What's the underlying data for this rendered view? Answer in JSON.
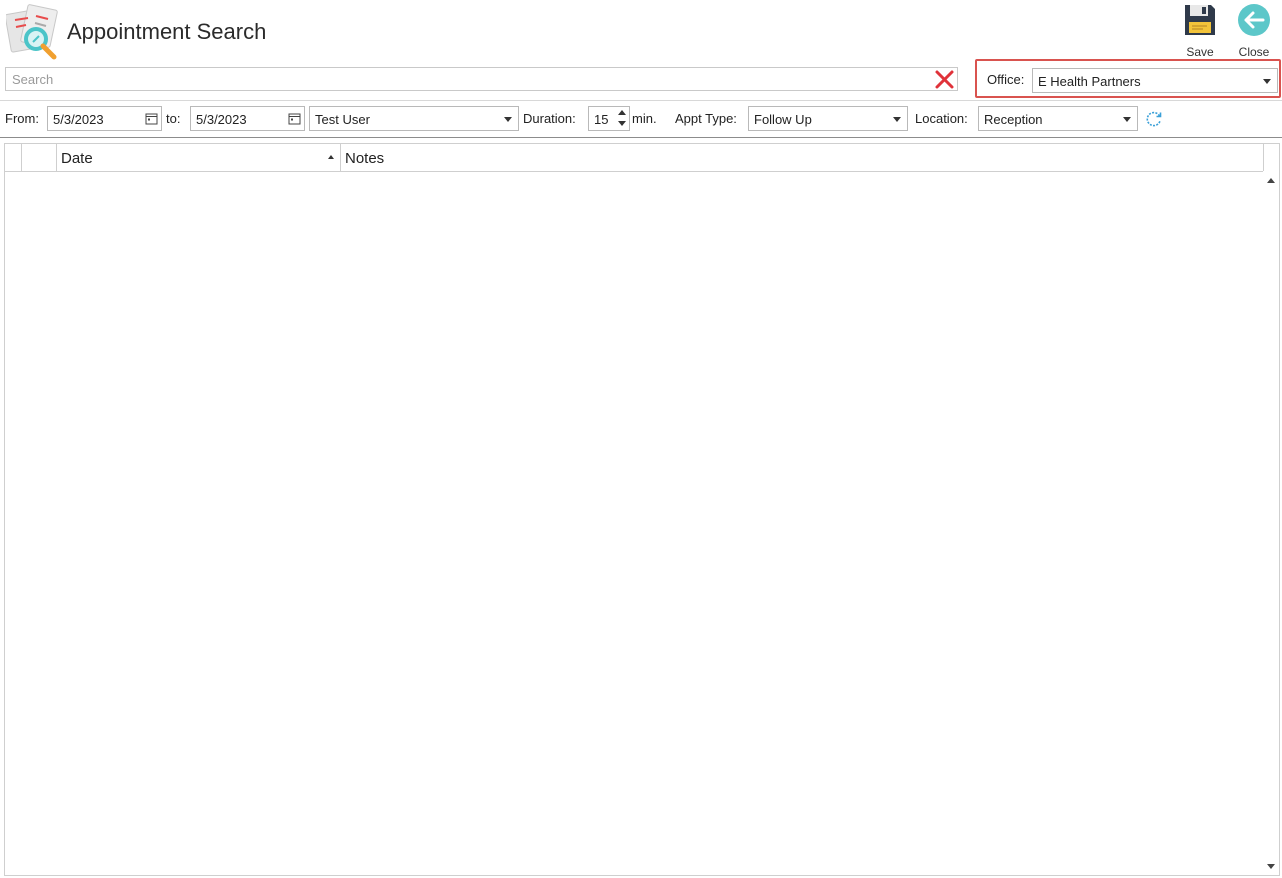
{
  "header": {
    "title": "Appointment Search",
    "app_icon": "appointment-search-icon"
  },
  "toolbar": {
    "save_label": "Save",
    "close_label": "Close",
    "save_icon": "floppy-disk-icon",
    "close_icon": "back-arrow-circle-icon"
  },
  "search": {
    "placeholder": "Search",
    "value": "",
    "clear_icon": "clear-x-icon"
  },
  "office": {
    "label": "Office:",
    "value": "E Health Partners",
    "highlight_color": "#d9534f"
  },
  "filters": {
    "from_label": "From:",
    "from_value": "5/3/2023",
    "to_label": "to:",
    "to_value": "5/3/2023",
    "user_value": "Test User",
    "duration_label": "Duration:",
    "duration_value": "15",
    "duration_unit": "min.",
    "appt_type_label": "Appt Type:",
    "appt_type_value": "Follow Up",
    "location_label": "Location:",
    "location_value": "Reception",
    "refresh_icon": "refresh-icon"
  },
  "grid": {
    "columns": [
      "",
      "",
      "Date",
      "Notes"
    ],
    "sort_column": "Date",
    "sort_direction": "ascending",
    "rows": []
  },
  "colors": {
    "accent_teal": "#4bc4c8",
    "close_teal": "#5cc7c9",
    "save_dark": "#2f3a4a",
    "save_yellow": "#f2c33a",
    "refresh_blue": "#3aa0d8",
    "clear_red": "#e0323a"
  }
}
